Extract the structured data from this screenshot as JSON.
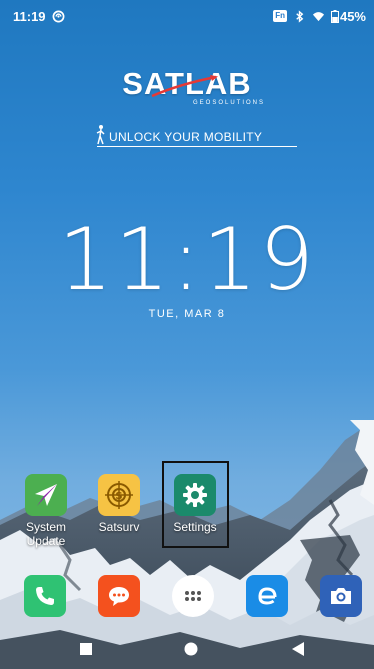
{
  "status_bar": {
    "time": "11:19",
    "fn_label": "Fn",
    "battery": "45%",
    "icons": [
      "sync-icon",
      "bluetooth-icon",
      "wifi-icon",
      "battery-icon"
    ]
  },
  "branding": {
    "logo_text": "SATLAB",
    "logo_sub": "GEOSOLUTIONS",
    "slogan": "UNLOCK YOUR MOBILITY"
  },
  "clock": {
    "time": "11:19",
    "date": "TUE, MAR 8"
  },
  "apps": [
    {
      "label": "System\nUpdate",
      "icon": "paper-plane-icon",
      "color": "#4caf50"
    },
    {
      "label": "Satsurv",
      "icon": "crosshair-icon",
      "color": "#f6c344"
    },
    {
      "label": "Settings",
      "icon": "gear-icon",
      "color": "#1b8a6b"
    }
  ],
  "dock": [
    {
      "name": "phone",
      "icon": "phone-icon",
      "color": "#2fc273"
    },
    {
      "name": "messages",
      "icon": "message-icon",
      "color": "#f4511e"
    },
    {
      "name": "app-drawer",
      "icon": "app-drawer-icon",
      "color": "#ffffff"
    },
    {
      "name": "browser",
      "icon": "browser-icon",
      "color": "#1a8ce6"
    },
    {
      "name": "camera",
      "icon": "camera-icon",
      "color": "#2f62b8"
    }
  ],
  "nav": [
    "recents-icon",
    "home-icon",
    "back-icon"
  ]
}
